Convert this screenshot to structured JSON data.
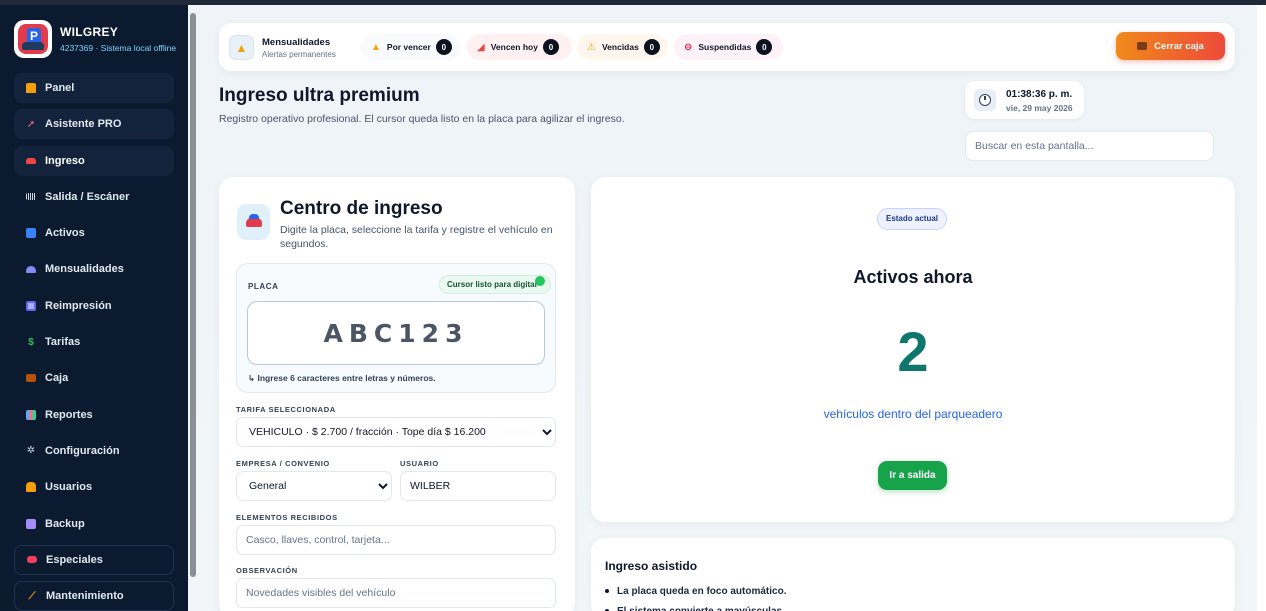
{
  "brand": {
    "name": "WILGREY",
    "subtitle": "4237369 · Sistema local offline"
  },
  "sidebar": {
    "items": [
      {
        "label": "Panel",
        "icon": "store-icon"
      },
      {
        "label": "Asistente PRO",
        "icon": "rocket-icon"
      },
      {
        "label": "Ingreso",
        "icon": "car-icon"
      },
      {
        "label": "Salida / Escáner",
        "icon": "barcode-icon"
      },
      {
        "label": "Activos",
        "icon": "parking-icon"
      },
      {
        "label": "Mensualidades",
        "icon": "users-icon"
      },
      {
        "label": "Reimpresión",
        "icon": "printer-icon"
      },
      {
        "label": "Tarifas",
        "icon": "dollar-icon"
      },
      {
        "label": "Caja",
        "icon": "briefcase-icon"
      },
      {
        "label": "Reportes",
        "icon": "chart-icon"
      },
      {
        "label": "Configuración",
        "icon": "gear-icon"
      },
      {
        "label": "Usuarios",
        "icon": "user-lock-icon"
      },
      {
        "label": "Backup",
        "icon": "floppy-icon"
      },
      {
        "label": "Especiales",
        "icon": "tag-icon"
      },
      {
        "label": "Mantenimiento",
        "icon": "broom-icon"
      }
    ],
    "active": "Ingreso"
  },
  "alerts": {
    "title": "Mensualidades",
    "subtitle": "Alertas permanentes",
    "items": [
      {
        "label": "Por vencer",
        "count": "0",
        "icon": "bell-icon"
      },
      {
        "label": "Vencen hoy",
        "count": "0",
        "icon": "siren-icon"
      },
      {
        "label": "Vencidas",
        "count": "0",
        "icon": "warning-icon"
      },
      {
        "label": "Suspendidas",
        "count": "0",
        "icon": "no-entry-icon"
      }
    ],
    "close_button": "Cerrar caja"
  },
  "header": {
    "title": "Ingreso ultra premium",
    "subtitle": "Registro operativo profesional. El cursor queda listo en la placa para agilizar el ingreso."
  },
  "clock": {
    "time": "01:38:36 p. m.",
    "date": "vie, 29 may 2026"
  },
  "search": {
    "placeholder": "Buscar en esta pantalla..."
  },
  "entry": {
    "title": "Centro de ingreso",
    "subtitle": "Digite la placa, seleccione la tarifa y registre el vehículo en segundos.",
    "placa_label": "PLACA",
    "ready_badge": "Cursor listo para digitar",
    "placa_value": "ABC123",
    "placa_hint": "↳ Ingrese 6 caracteres entre letras y números.",
    "tarifa_label": "TARIFA SELECCIONADA",
    "tarifa_value": "VEHICULO · $ 2.700 / fracción · Tope día $ 16.200",
    "empresa_label": "EMPRESA / CONVENIO",
    "empresa_value": "General",
    "usuario_label": "USUARIO",
    "usuario_value": "WILBER",
    "elementos_label": "ELEMENTOS RECIBIDOS",
    "elementos_placeholder": "Casco, llaves, control, tarjeta...",
    "observacion_label": "OBSERVACIÓN",
    "observacion_placeholder": "Novedades visibles del vehículo"
  },
  "status": {
    "badge": "Estado actual",
    "title": "Activos ahora",
    "count": "2",
    "subtitle": "vehículos dentro del parqueadero",
    "button": "Ir a salida"
  },
  "assist": {
    "title": "Ingreso asistido",
    "items": [
      "La placa queda en foco automático.",
      "El sistema convierte a mayúsculas."
    ]
  }
}
